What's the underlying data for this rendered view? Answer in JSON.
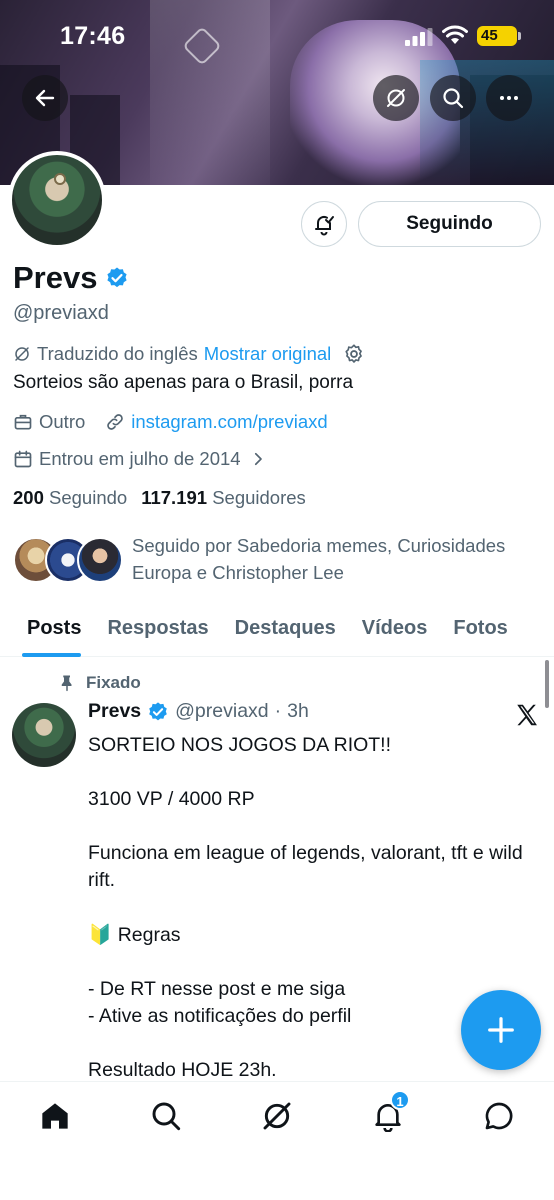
{
  "status_bar": {
    "time": "17:46",
    "battery": "45"
  },
  "profile": {
    "name": "Prevs",
    "handle": "@previaxd",
    "translation_note": "Traduzido do inglês",
    "show_original": "Mostrar original",
    "bio": "Sorteios são apenas para o Brasil, porra",
    "category": "Outro",
    "link": "instagram.com/previaxd",
    "joined": "Entrou em julho de 2014",
    "following_count": "200",
    "following_label": "Seguindo",
    "followers_count": "117.191",
    "followers_label": "Seguidores",
    "followed_by": "Seguido por Sabedoria memes, Curiosidades Europa e Christopher Lee",
    "follow_button_label": "Seguindo"
  },
  "tabs": [
    {
      "label": "Posts",
      "active": true
    },
    {
      "label": "Respostas"
    },
    {
      "label": "Destaques"
    },
    {
      "label": "Vídeos"
    },
    {
      "label": "Fotos"
    }
  ],
  "post": {
    "pinned_label": "Fixado",
    "author_name": "Prevs",
    "author_handle": "@previaxd",
    "separator": "·",
    "time": "3h",
    "lines": [
      "SORTEIO NOS JOGOS DA RIOT!!",
      "",
      "3100 VP / 4000 RP",
      "",
      "Funciona em league of legends, valorant, tft e wild rift.",
      "",
      "🔰 Regras",
      "",
      "- De RT nesse post e me siga",
      "- Ative as notificações do perfil",
      "",
      "Resultado HOJE 23h."
    ]
  },
  "bottom_nav": {
    "notifications_badge": "1"
  },
  "colors": {
    "accent": "#1d9bf0",
    "text": "#0f1419",
    "secondary": "#536471",
    "battery": "#f5d200"
  }
}
